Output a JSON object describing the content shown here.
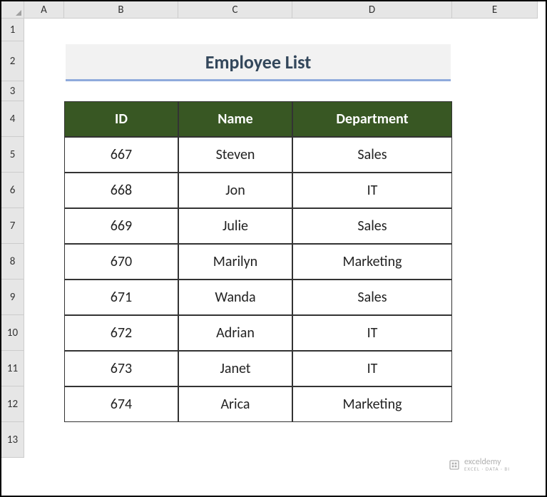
{
  "columns": [
    "A",
    "B",
    "C",
    "D",
    "E"
  ],
  "rows": [
    "1",
    "2",
    "3",
    "4",
    "5",
    "6",
    "7",
    "8",
    "9",
    "10",
    "11",
    "12",
    "13"
  ],
  "title": "Employee List",
  "headers": {
    "id": "ID",
    "name": "Name",
    "dept": "Department"
  },
  "data": [
    {
      "id": "667",
      "name": "Steven",
      "dept": "Sales"
    },
    {
      "id": "668",
      "name": "Jon",
      "dept": "IT"
    },
    {
      "id": "669",
      "name": "Julie",
      "dept": "Sales"
    },
    {
      "id": "670",
      "name": "Marilyn",
      "dept": "Marketing"
    },
    {
      "id": "671",
      "name": "Wanda",
      "dept": "Sales"
    },
    {
      "id": "672",
      "name": "Adrian",
      "dept": "IT"
    },
    {
      "id": "673",
      "name": "Janet",
      "dept": "IT"
    },
    {
      "id": "674",
      "name": "Arica",
      "dept": "Marketing"
    }
  ],
  "watermark": {
    "brand": "exceldemy",
    "tag": "EXCEL · DATA · BI"
  }
}
